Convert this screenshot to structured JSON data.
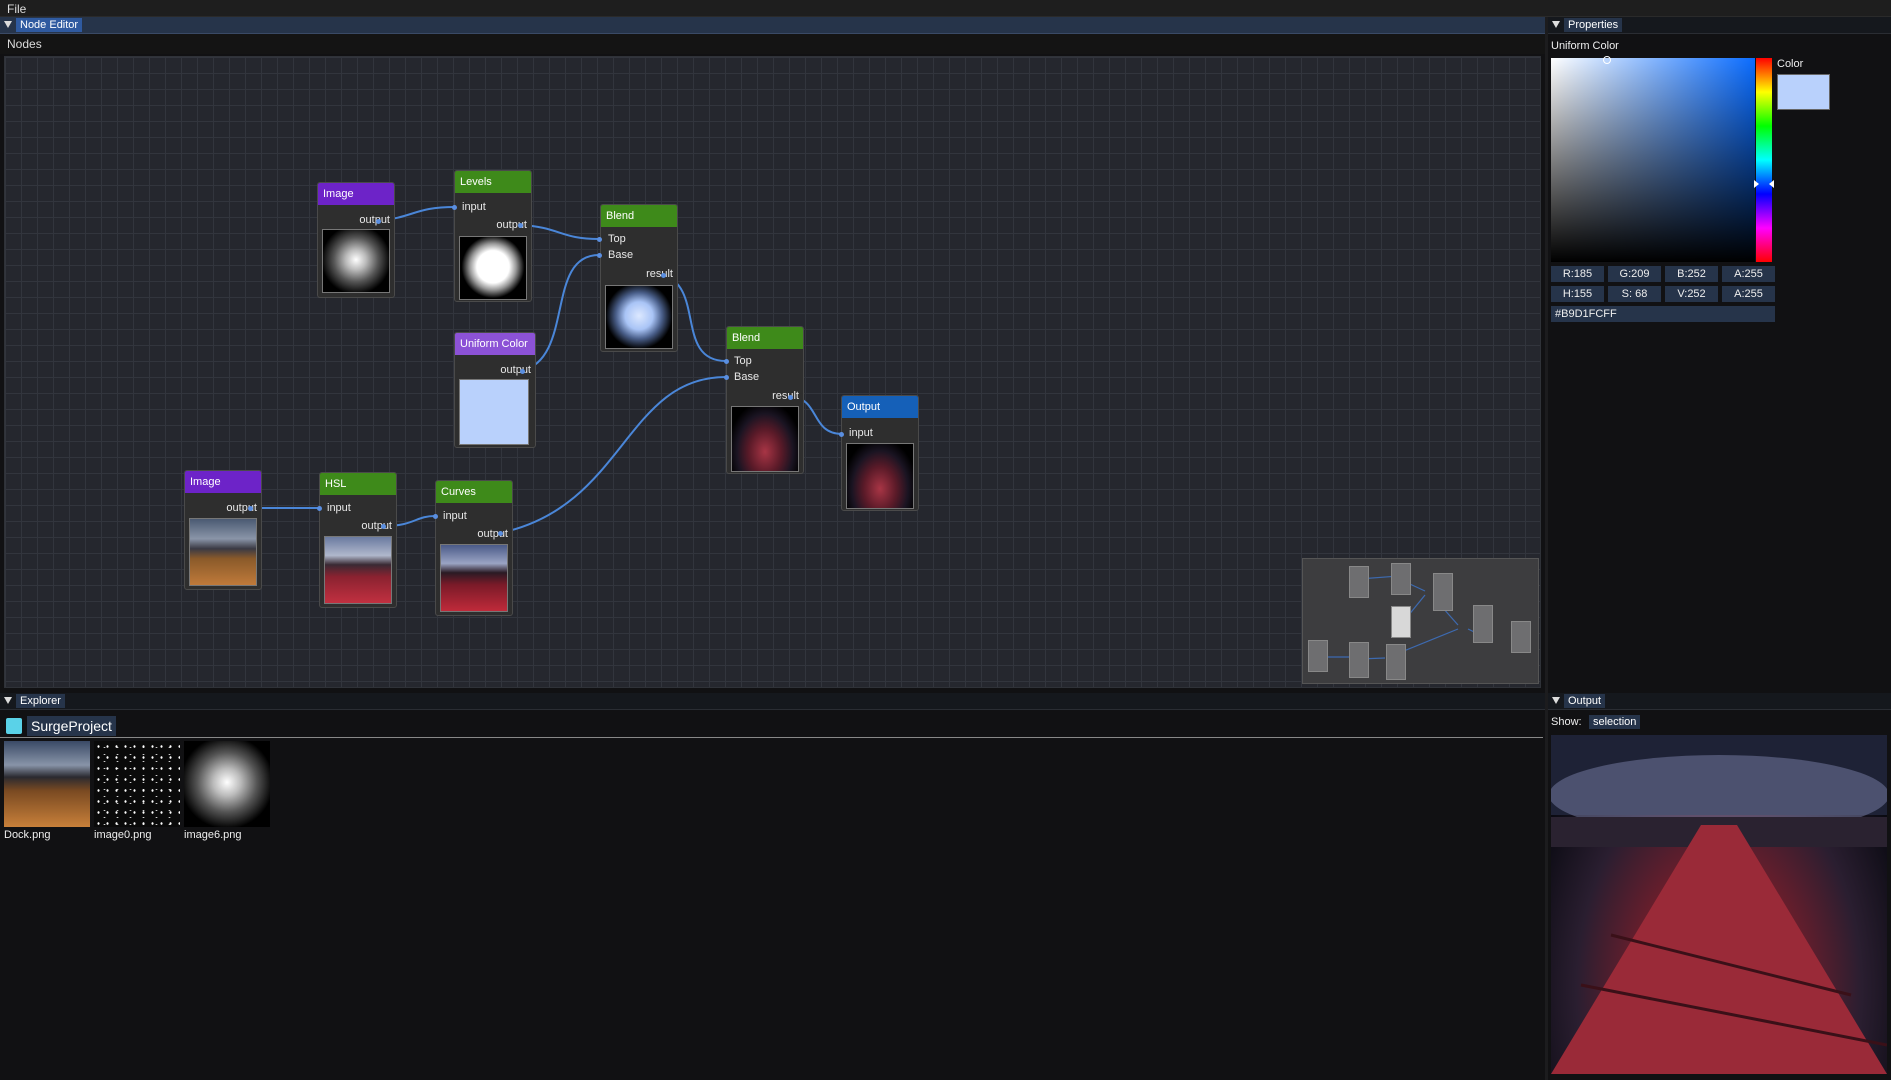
{
  "menu": {
    "file": "File"
  },
  "editor": {
    "title": "Node Editor",
    "nodes_header": "Nodes",
    "nodes": {
      "image1": {
        "title": "Image",
        "output": "output"
      },
      "levels": {
        "title": "Levels",
        "input": "input",
        "output": "output"
      },
      "blend1": {
        "title": "Blend",
        "top": "Top",
        "base": "Base",
        "result": "result"
      },
      "uniform": {
        "title": "Uniform Color",
        "output": "output"
      },
      "blend2": {
        "title": "Blend",
        "top": "Top",
        "base": "Base",
        "result": "result"
      },
      "output": {
        "title": "Output",
        "input": "input"
      },
      "image2": {
        "title": "Image",
        "output": "output"
      },
      "hsl": {
        "title": "HSL",
        "input": "input",
        "output": "output"
      },
      "curves": {
        "title": "Curves",
        "input": "input",
        "output": "output"
      }
    }
  },
  "properties": {
    "title": "Properties",
    "section": "Uniform Color",
    "color_label": "Color",
    "swatch_color": "#B9D1FC",
    "rgba": [
      "R:185",
      "G:209",
      "B:252",
      "A:255"
    ],
    "hsva": [
      "H:155",
      "S: 68",
      "V:252",
      "A:255"
    ],
    "hex": "#B9D1FCFF"
  },
  "explorer": {
    "title": "Explorer",
    "project": "SurgeProject",
    "files": [
      "Dock.png",
      "image0.png",
      "image6.png"
    ]
  },
  "output_panel": {
    "title": "Output",
    "show_label": "Show:",
    "show_value": "selection"
  },
  "icons": [
    "collapse-triangle-icon",
    "folder-icon"
  ]
}
